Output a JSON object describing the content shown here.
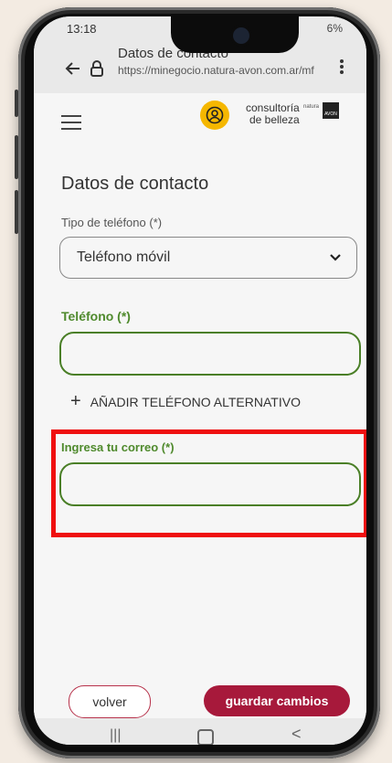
{
  "status": {
    "time": "13:18",
    "right": "6%"
  },
  "browser": {
    "title": "Datos de contacto",
    "url": "https://minegocio.natura-avon.com.ar/mf"
  },
  "brand": {
    "line1": "consultoría",
    "line2": "de belleza",
    "natura": "natura",
    "avon": "AVON"
  },
  "form": {
    "heading": "Datos de contacto",
    "phone_type_label": "Tipo de teléfono (*)",
    "phone_type_value": "Teléfono móvil",
    "phone_label": "Teléfono (*)",
    "phone_value": "",
    "add_alt_label": "AÑADIR TELÉFONO ALTERNATIVO",
    "email_label": "Ingresa tu correo (*)",
    "email_value": ""
  },
  "footer": {
    "back_label": "volver",
    "save_label": "guardar cambios"
  },
  "colors": {
    "brand_red": "#a7193b",
    "green": "#4a7f27",
    "highlight": "#ef1010",
    "avatar": "#f5b700"
  }
}
